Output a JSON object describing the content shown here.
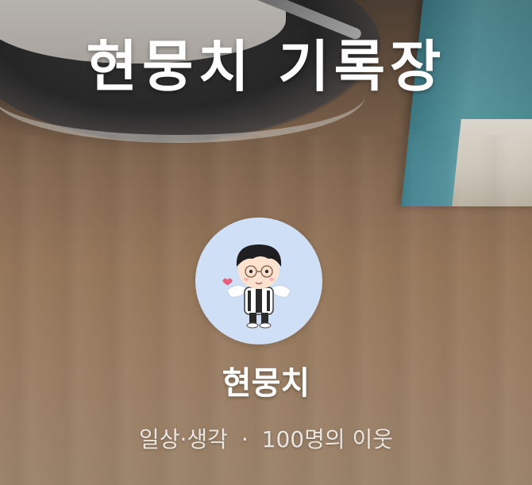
{
  "blog": {
    "title": "현뭉치 기록장",
    "nickname": "현뭉치",
    "category": "일상·생각",
    "separator": "·",
    "neighbors": "100명의 이웃"
  },
  "avatar": {
    "icon": "cartoon-boy-avatar",
    "background_color": "#cfe0f6"
  },
  "cover": {
    "icon": "coffee-cup-and-book-photo"
  }
}
